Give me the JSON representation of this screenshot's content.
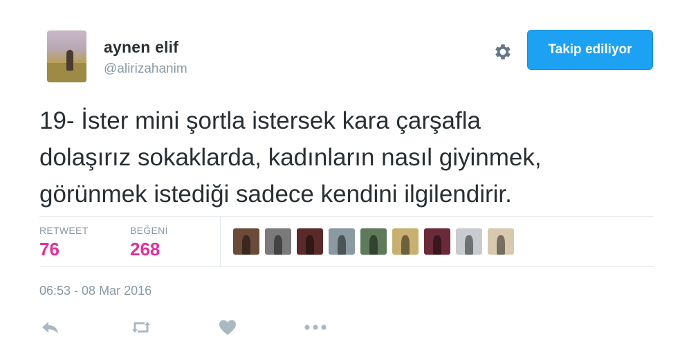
{
  "user": {
    "name": "aynen elif",
    "handle": "@alirizahanim",
    "follow_label": "Takip ediliyor"
  },
  "tweet": {
    "lines": [
      "19- İster mini şortla istersek kara çarşafla",
      "dolaşırız sokaklarda, kadınların nasıl giyinmek,",
      "görünmek istediği sadece kendini ilgilendirir."
    ]
  },
  "stats": {
    "retweet_label": "RETWEET",
    "retweet_count": "76",
    "like_label": "BEĞENİ",
    "like_count": "268"
  },
  "likers": [
    {
      "name": "liker-avatar-1",
      "color": "#6b4a3a"
    },
    {
      "name": "liker-avatar-2",
      "color": "#7a7a7a"
    },
    {
      "name": "liker-avatar-3",
      "color": "#5a2a2a"
    },
    {
      "name": "liker-avatar-4",
      "color": "#8a9aa0"
    },
    {
      "name": "liker-avatar-5",
      "color": "#5f7a5a"
    },
    {
      "name": "liker-avatar-6",
      "color": "#c8b070"
    },
    {
      "name": "liker-avatar-7",
      "color": "#6a2a3a"
    },
    {
      "name": "liker-avatar-8",
      "color": "#c8ccd0"
    },
    {
      "name": "liker-avatar-9",
      "color": "#d8c8b0"
    }
  ],
  "timestamp": "06:53 - 08 Mar 2016",
  "actions": [
    {
      "name": "reply-icon"
    },
    {
      "name": "retweet-icon"
    },
    {
      "name": "like-icon"
    },
    {
      "name": "more-icon"
    }
  ],
  "colors": {
    "accent": "#1da1f2",
    "count": "#e0309a",
    "muted": "#8899a6",
    "text": "#292f33"
  }
}
